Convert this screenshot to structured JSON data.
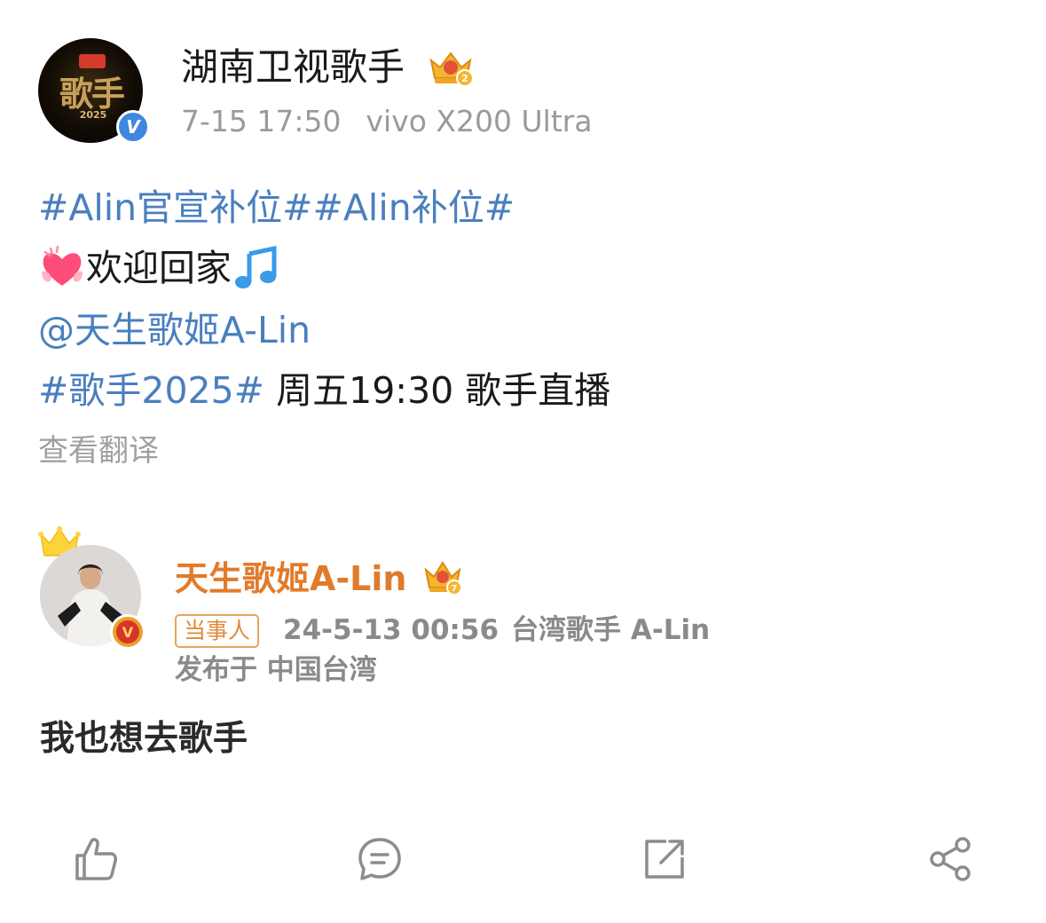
{
  "author": {
    "name": "湖南卫视歌手",
    "avatar_text": "歌手",
    "avatar_year": "2025",
    "verified_icon": "blue-v-icon",
    "badge_icon": "crown-level-2-icon",
    "time": "7-15 17:50",
    "device": "vivo X200 Ultra"
  },
  "post": {
    "line1": "#Alin官宣补位##Alin补位#",
    "line2_text": "欢迎回家",
    "line2_icons": [
      "growing-heart-icon",
      "music-note-icon"
    ],
    "mention": "@天生歌姬A-Lin",
    "topic": "#歌手2025#",
    "topic_after": "周五19:30 歌手直播",
    "translate": "查看翻译"
  },
  "quoted": {
    "name": "天生歌姬A-Lin",
    "tag": "当事人",
    "time": "24-5-13 00:56",
    "description": "台湾歌手 A-Lin",
    "location": "发布于 中国台湾",
    "text": "我也想去歌手"
  },
  "actions": [
    {
      "name": "like",
      "icon": "thumbs-up-icon"
    },
    {
      "name": "comment",
      "icon": "comment-icon"
    },
    {
      "name": "repost",
      "icon": "repost-icon"
    },
    {
      "name": "share",
      "icon": "share-icon"
    }
  ],
  "colors": {
    "link_blue": "#4a7fbf",
    "quoted_name_orange": "#e17b2c",
    "meta_gray": "#9a9a9a",
    "verify_blue": "#3f87e0"
  }
}
